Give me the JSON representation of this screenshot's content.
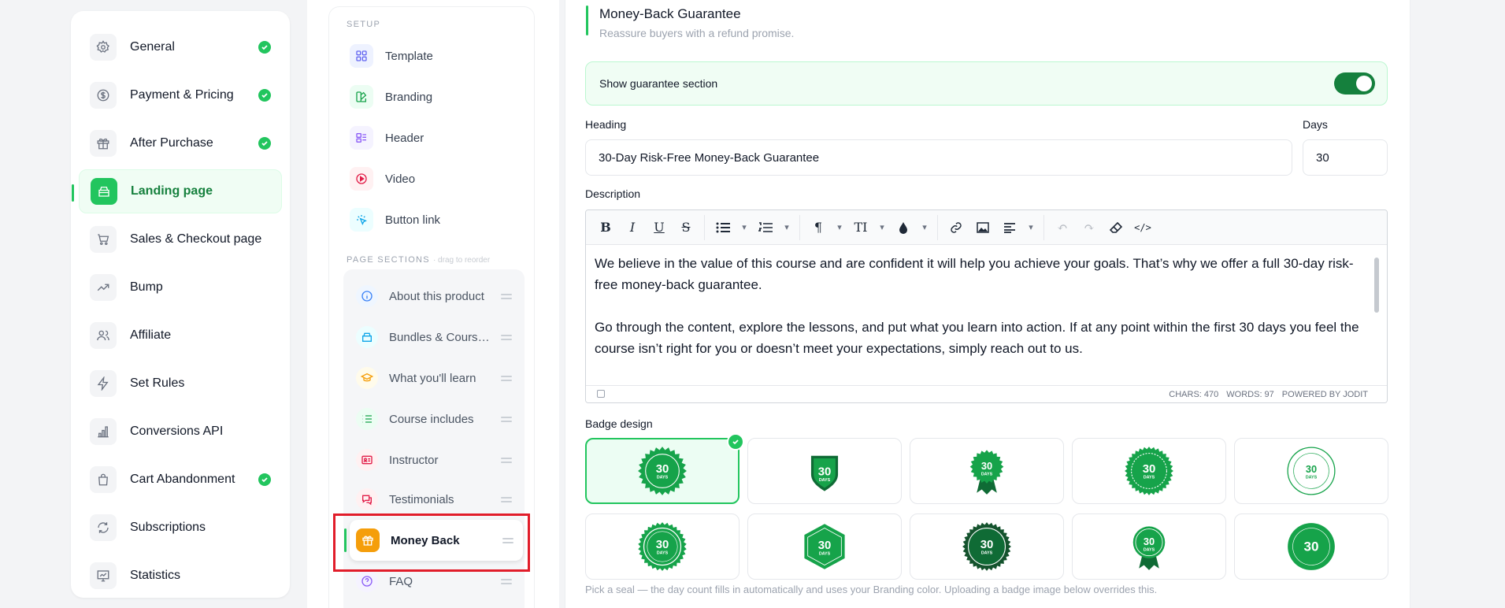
{
  "nav": {
    "items": [
      {
        "label": "General",
        "icon": "gear-icon",
        "done": true
      },
      {
        "label": "Payment & Pricing",
        "icon": "dollar-icon",
        "done": true
      },
      {
        "label": "After Purchase",
        "icon": "gift-icon",
        "done": true
      },
      {
        "label": "Landing page",
        "icon": "landing-icon",
        "done": false,
        "active": true
      },
      {
        "label": "Sales & Checkout page",
        "icon": "cart-icon",
        "done": false
      },
      {
        "label": "Bump",
        "icon": "trend-icon",
        "done": false
      },
      {
        "label": "Affiliate",
        "icon": "users-icon",
        "done": false
      },
      {
        "label": "Set Rules",
        "icon": "bolt-icon",
        "done": false
      },
      {
        "label": "Conversions API",
        "icon": "bars-icon",
        "done": false
      },
      {
        "label": "Cart Abandonment",
        "icon": "bag-icon",
        "done": true
      },
      {
        "label": "Subscriptions",
        "icon": "refresh-icon",
        "done": false
      },
      {
        "label": "Statistics",
        "icon": "chart-icon",
        "done": false
      }
    ]
  },
  "middle": {
    "setup_label": "SETUP",
    "setup_items": [
      {
        "label": "Template",
        "icon": "grid-icon"
      },
      {
        "label": "Branding",
        "icon": "paint-icon"
      },
      {
        "label": "Header",
        "icon": "header-icon"
      },
      {
        "label": "Video",
        "icon": "play-icon"
      },
      {
        "label": "Button link",
        "icon": "click-icon"
      }
    ],
    "sections_label": "PAGE SECTIONS",
    "sections_hint": "· drag to reorder",
    "sections": [
      {
        "label": "About this product",
        "icon": "info-icon"
      },
      {
        "label": "Bundles & Courses Included",
        "icon": "stack-icon"
      },
      {
        "label": "What you'll learn",
        "icon": "cap-icon"
      },
      {
        "label": "Course includes",
        "icon": "list-icon"
      },
      {
        "label": "Instructor",
        "icon": "id-card-icon"
      },
      {
        "label": "Testimonials",
        "icon": "chat-icon"
      },
      {
        "label": "Money Back",
        "icon": "gift-icon",
        "active": true
      },
      {
        "label": "FAQ",
        "icon": "question-icon"
      }
    ]
  },
  "main": {
    "title": "Money-Back Guarantee",
    "subtitle": "Reassure buyers with a refund promise.",
    "toggle_label": "Show guarantee section",
    "toggle_on": true,
    "heading_label": "Heading",
    "heading_value": "30-Day Risk-Free Money-Back Guarantee",
    "days_label": "Days",
    "days_value": "30",
    "description_label": "Description",
    "description_paragraphs": [
      "We believe in the value of this course and are confident it will help you achieve your goals. That’s why we offer a full 30-day risk-free money-back guarantee.",
      "Go through the content, explore the lessons, and put what you learn into action. If at any point within the first 30 days you feel the course isn’t right for you or doesn’t meet your expectations, simply reach out to us."
    ],
    "editor_status": {
      "chars": "CHARS: 470",
      "words": "WORDS: 97",
      "powered": "POWERED BY JODIT"
    },
    "badge_label": "Badge design",
    "badge_hint": "Pick a seal — the day count fills in automatically and uses your Branding color. Uploading a badge image below overrides this.",
    "badge_number": "30",
    "badge_unit": "DAYS",
    "selected_badge": 0
  },
  "colors": {
    "accent": "#22c55e",
    "accent_dark": "#15803d",
    "seal": "#16a34a",
    "seal_dark": "#0f6b35",
    "highlight": "#e11d2a"
  }
}
